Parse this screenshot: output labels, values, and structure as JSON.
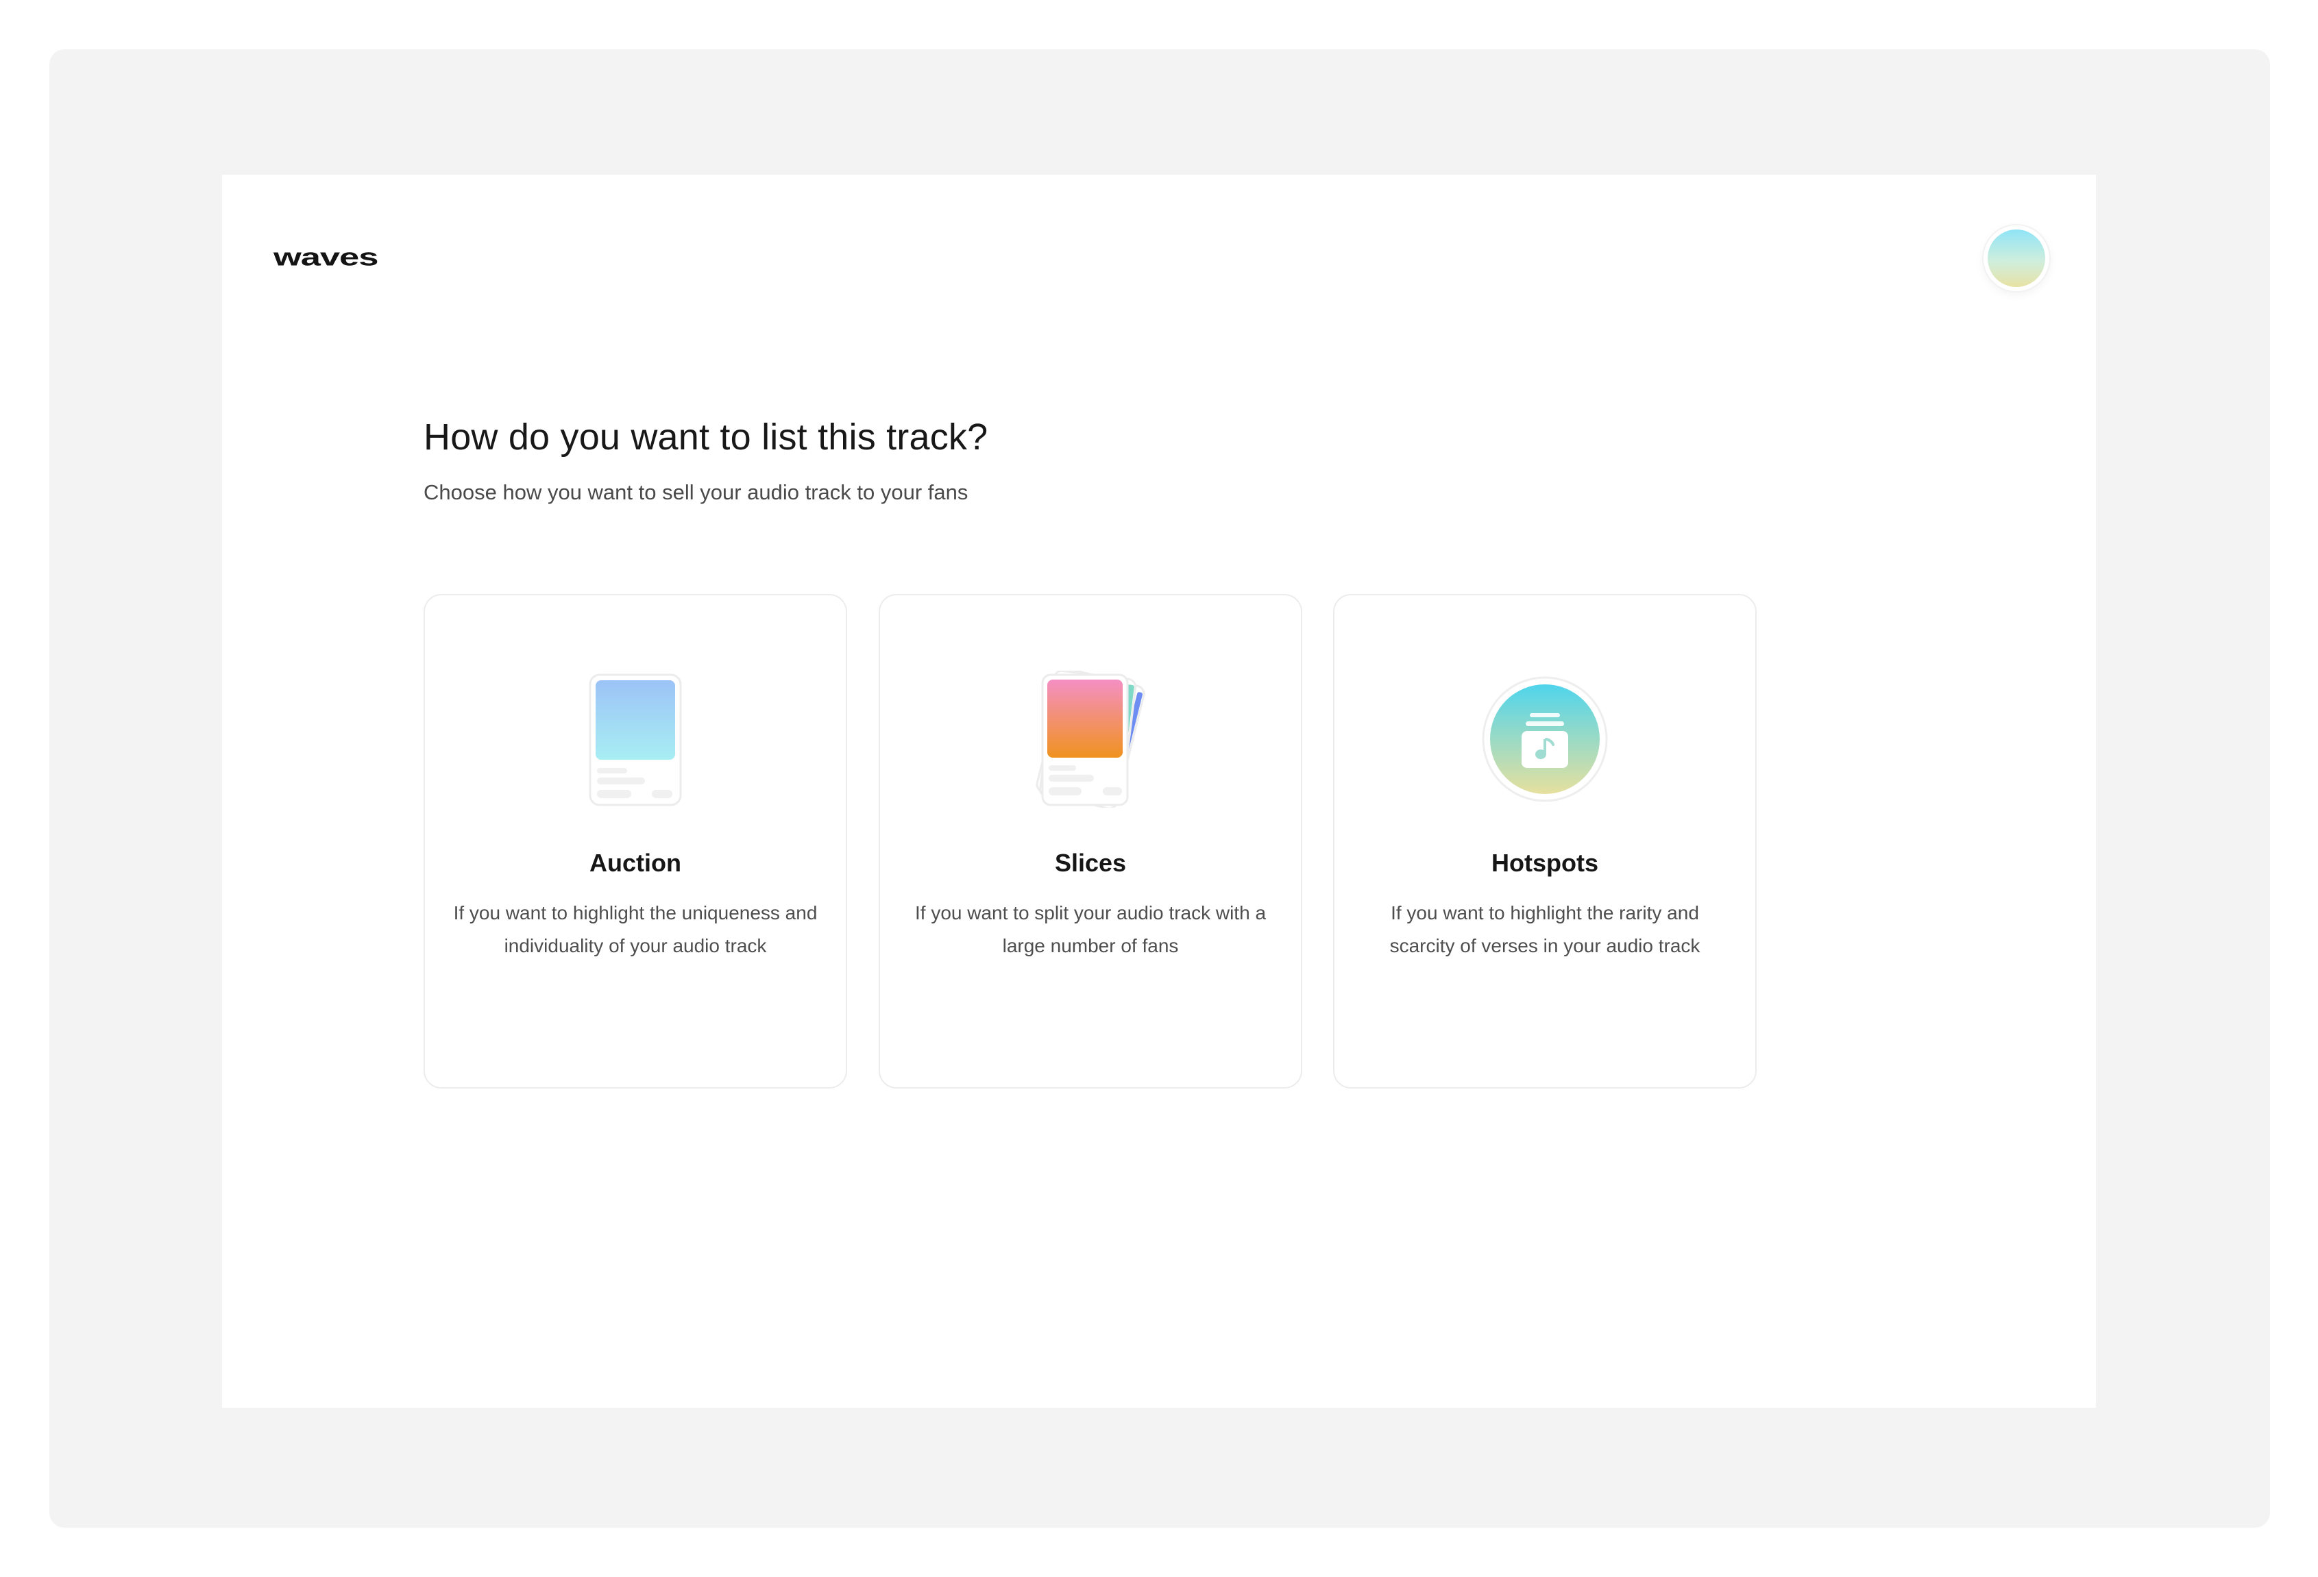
{
  "header": {
    "logo_text": "waves"
  },
  "main": {
    "title": "How do you want to list this track?",
    "subtitle": "Choose how you want to sell your audio track to your fans",
    "options": [
      {
        "title": "Auction",
        "description": "If you want to highlight the uniqueness and individuality of your audio track",
        "icon": "single-card-icon"
      },
      {
        "title": "Slices",
        "description": "If you want to split your audio track with a large number of fans",
        "icon": "stacked-cards-icon"
      },
      {
        "title": "Hotspots",
        "description": "If you want to highlight the rarity and scarcity of verses in your audio track",
        "icon": "music-stack-icon"
      }
    ]
  },
  "colors": {
    "auction_gradient": [
      "#9cc3f7",
      "#a8eef3"
    ],
    "slices_gradient": [
      "#f48fc4",
      "#f0921f"
    ],
    "hotspots_gradient": [
      "#4fd4ec",
      "#e6e09e"
    ],
    "backdrop": "#f3f3f3"
  }
}
